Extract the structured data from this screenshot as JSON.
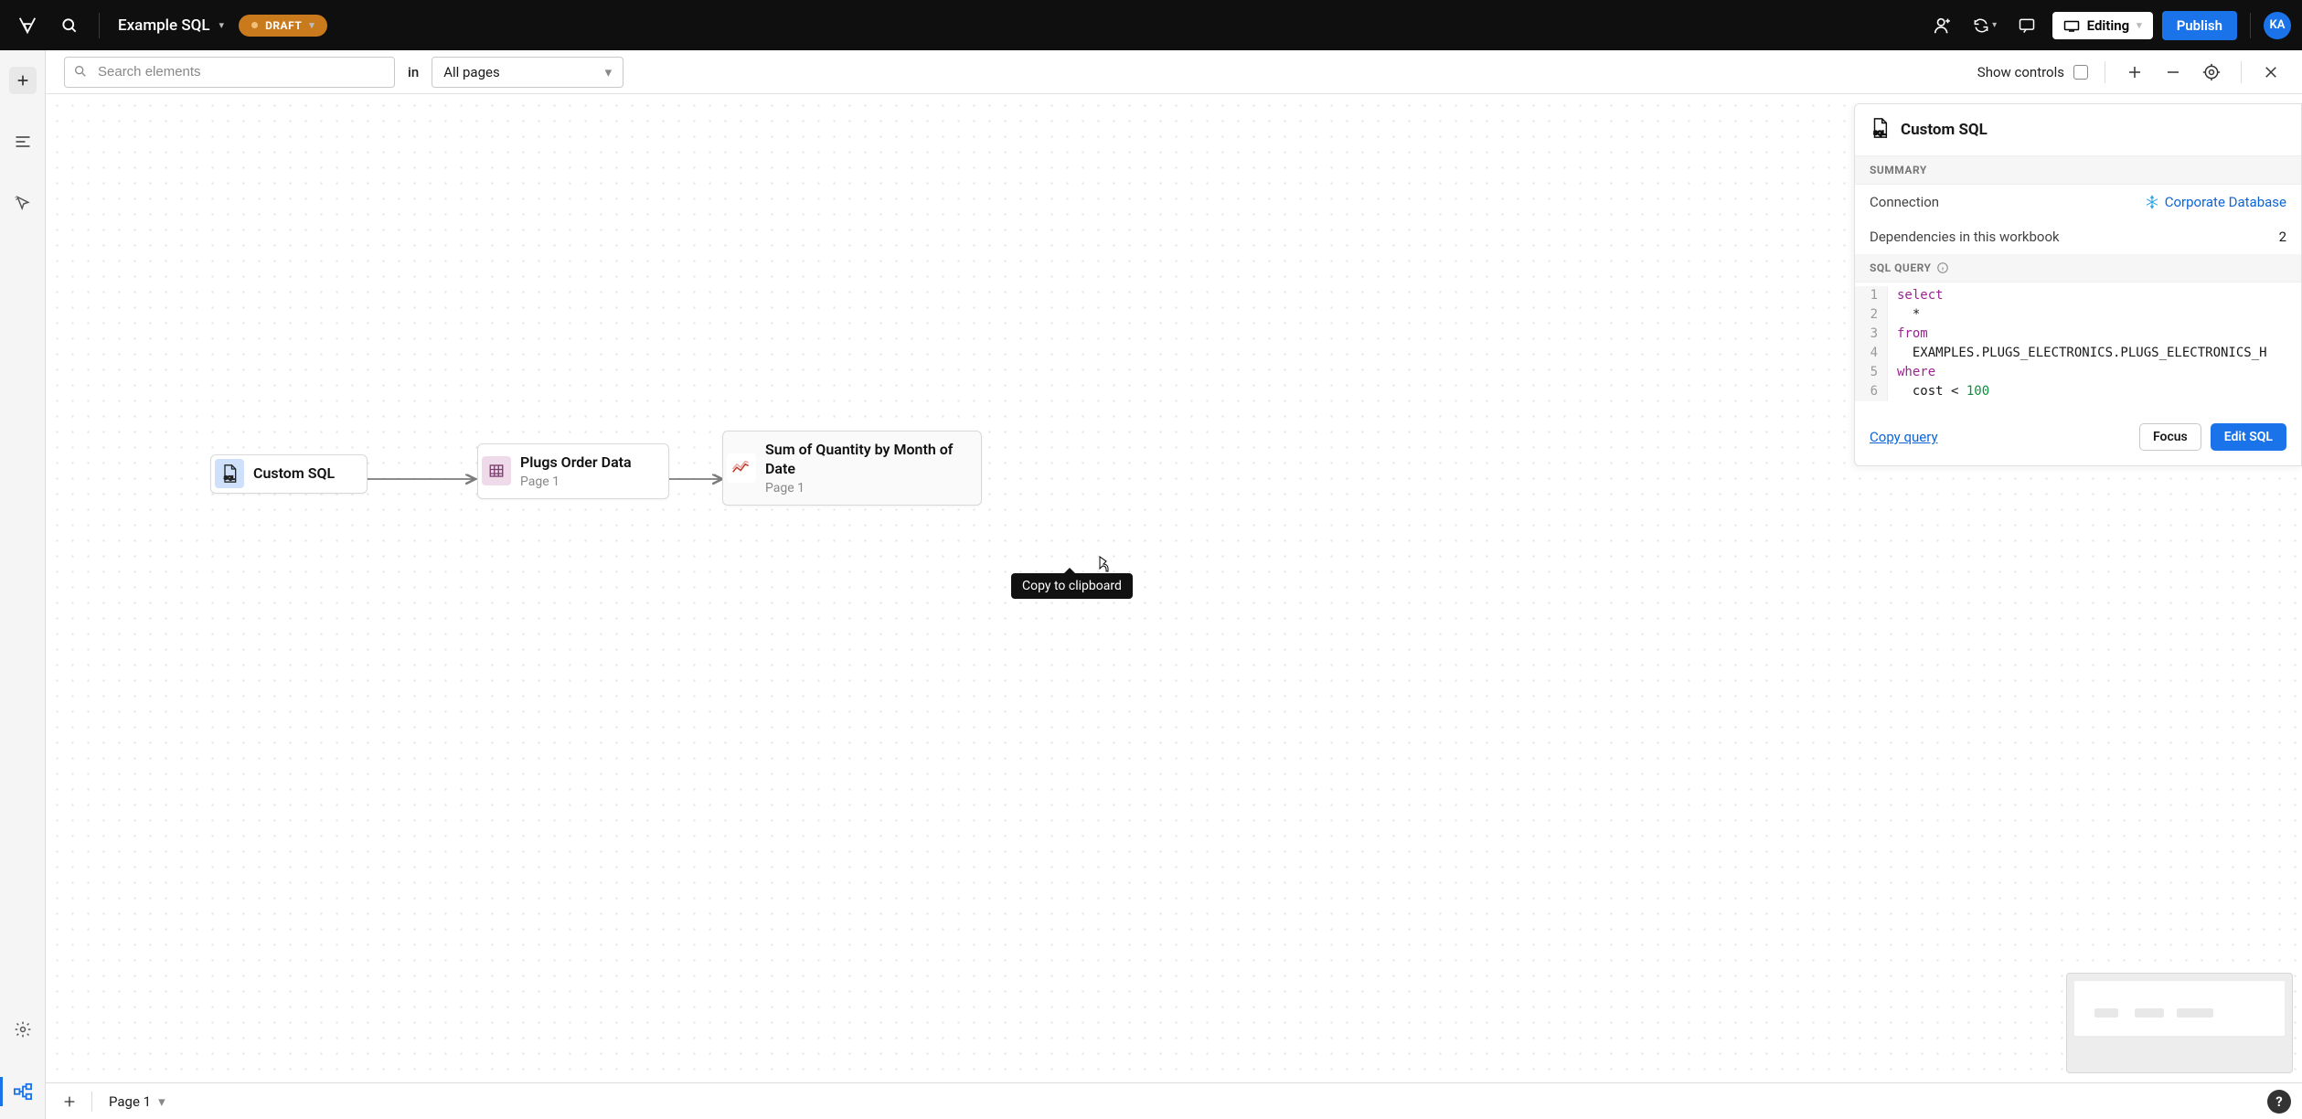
{
  "topbar": {
    "doc_title": "Example SQL",
    "draft_label": "DRAFT",
    "mode_label": "Editing",
    "publish_label": "Publish",
    "avatar": "KA"
  },
  "toolbar": {
    "search_placeholder": "Search elements",
    "in_label": "in",
    "page_scope": "All pages",
    "show_controls_label": "Show controls"
  },
  "nodes": {
    "custom_sql": {
      "title": "Custom SQL"
    },
    "plugs": {
      "title": "Plugs Order Data",
      "sub": "Page 1"
    },
    "sumqty": {
      "title": "Sum of Quantity by Month of Date",
      "sub": "Page 1"
    }
  },
  "panel": {
    "title": "Custom SQL",
    "summary_label": "SUMMARY",
    "connection_label": "Connection",
    "connection_value": "Corporate Database",
    "deps_label": "Dependencies in this workbook",
    "deps_value": "2",
    "sql_label": "SQL QUERY",
    "sql_lines": [
      {
        "n": "1",
        "pre": "",
        "kw": "select",
        "post": ""
      },
      {
        "n": "2",
        "pre": "  *",
        "kw": "",
        "post": ""
      },
      {
        "n": "3",
        "pre": "",
        "kw": "from",
        "post": ""
      },
      {
        "n": "4",
        "pre": "  EXAMPLES.PLUGS_ELECTRONICS.PLUGS_ELECTRONICS_H",
        "kw": "",
        "post": ""
      },
      {
        "n": "5",
        "pre": "",
        "kw": "where",
        "post": ""
      },
      {
        "n": "6",
        "pre": "  cost < ",
        "kw": "",
        "post": "",
        "num": "100"
      }
    ],
    "copy_label": "Copy query",
    "focus_label": "Focus",
    "edit_label": "Edit SQL"
  },
  "tooltip": {
    "text": "Copy to clipboard"
  },
  "footer": {
    "page_tab": "Page 1"
  }
}
